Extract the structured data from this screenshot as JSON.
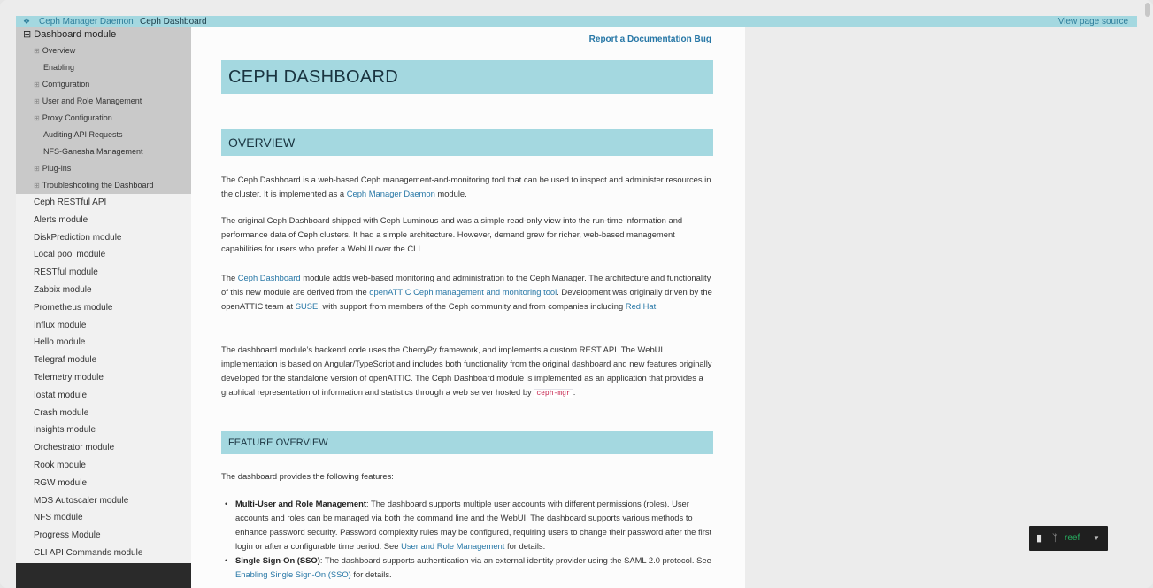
{
  "topbar": {
    "home_icon": "home-icon",
    "crumb1": "Ceph Manager Daemon",
    "crumb2": "Ceph Dashboard",
    "view_source": "View page source"
  },
  "sidebar": {
    "current": "⊟ Dashboard module",
    "subitems": [
      {
        "label": "Overview",
        "expander": "⊞",
        "level": 2
      },
      {
        "label": "Enabling",
        "expander": "",
        "level": 3
      },
      {
        "label": "Configuration",
        "expander": "⊞",
        "level": 2
      },
      {
        "label": "User and Role Management",
        "expander": "⊞",
        "level": 2
      },
      {
        "label": "Proxy Configuration",
        "expander": "⊞",
        "level": 2
      },
      {
        "label": "Auditing API Requests",
        "expander": "",
        "level": 3
      },
      {
        "label": "NFS-Ganesha Management",
        "expander": "",
        "level": 3
      },
      {
        "label": "Plug-ins",
        "expander": "⊞",
        "level": 2
      },
      {
        "label": "Troubleshooting the Dashboard",
        "expander": "⊞",
        "level": 2
      }
    ],
    "items": [
      "Ceph RESTful API",
      "Alerts module",
      "DiskPrediction module",
      "Local pool module",
      "RESTful module",
      "Zabbix module",
      "Prometheus module",
      "Influx module",
      "Hello module",
      "Telegraf module",
      "Telemetry module",
      "Iostat module",
      "Crash module",
      "Insights module",
      "Orchestrator module",
      "Rook module",
      "RGW module",
      "MDS Autoscaler module",
      "NFS module",
      "Progress Module",
      "CLI API Commands module"
    ]
  },
  "content": {
    "report_bug": "Report a Documentation Bug",
    "h1": "CEPH DASHBOARD",
    "h2_overview": "OVERVIEW",
    "p1": {
      "t1": "The Ceph Dashboard is a web-based Ceph management-and-monitoring tool that can be used to inspect and administer resources in the cluster. It is implemented as a ",
      "link": "Ceph Manager Daemon",
      "t2": " module."
    },
    "p2": "The original Ceph Dashboard shipped with Ceph Luminous and was a simple read-only view into the run-time information and performance data of Ceph clusters. It had a simple architecture. However, demand grew for richer, web-based management capabilities for users who prefer a WebUI over the CLI.",
    "p3": {
      "t1": "The ",
      "link1": "Ceph Dashboard",
      "t2": " module adds web-based monitoring and administration to the Ceph Manager. The architecture and functionality of this new module are derived from the ",
      "link2": "openATTIC Ceph management and monitoring tool",
      "t3": ". Development was originally driven by the openATTIC team at ",
      "link3": "SUSE",
      "t4": ", with support from members of the Ceph community and from companies including ",
      "link4": "Red Hat",
      "t5": "."
    },
    "p4": {
      "t1": "The dashboard module’s backend code uses the CherryPy framework, and implements a custom REST API. The WebUI implementation is based on Angular/TypeScript and includes both functionality from the original dashboard and new features originally developed for the standalone version of openATTIC. The Ceph Dashboard module is implemented as an application that provides a graphical representation of information and statistics through a web server hosted by ",
      "code": "ceph-mgr",
      "t2": "."
    },
    "h3_features": "FEATURE OVERVIEW",
    "p5": "The dashboard provides the following features:",
    "features": [
      {
        "title": "Multi-User and Role Management",
        "t1": ": The dashboard supports multiple user accounts with different permissions (roles). User accounts and roles can be managed via both the command line and the WebUI. The dashboard supports various methods to enhance password security. Password complexity rules may be configured, requiring users to change their password after the first login or after a configurable time period. See ",
        "link": "User and Role Management",
        "t2": " for details."
      },
      {
        "title": "Single Sign-On (SSO)",
        "t1": ": The dashboard supports authentication via an external identity provider using the SAML 2.0 protocol. See ",
        "link": "Enabling Single Sign-On (SSO)",
        "t2": " for details."
      }
    ]
  },
  "version_badge": {
    "book_icon": "book-icon",
    "branch_icon": "branch-icon",
    "version": "reef",
    "caret_icon": "caret-down-icon"
  },
  "colors": {
    "header_bg": "#a4d8e0",
    "link": "#2777a6",
    "sidebar_active": "#c9c9c9",
    "badge_version": "#27ae60"
  }
}
